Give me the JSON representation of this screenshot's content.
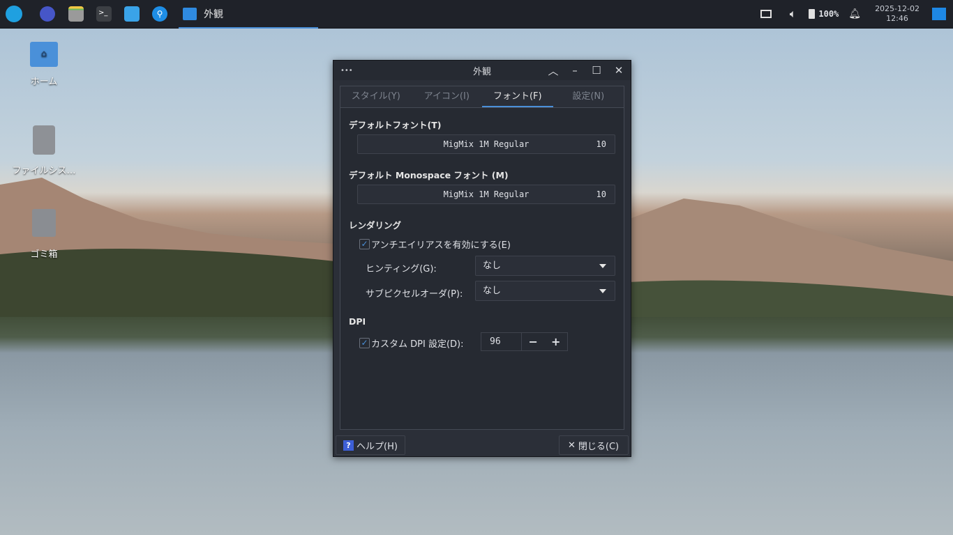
{
  "taskbar": {
    "active_window": "外観",
    "tray": {
      "battery": "100%",
      "date": "2025-12-02",
      "time": "12:46"
    }
  },
  "desktop": {
    "icons": [
      {
        "label": "ホーム"
      },
      {
        "label": "ファイルシス…"
      },
      {
        "label": "ゴミ箱"
      }
    ]
  },
  "window": {
    "title": "外観",
    "tabs": [
      {
        "label": "スタイル(Y)"
      },
      {
        "label": "アイコン(I)"
      },
      {
        "label": "フォント(F)"
      },
      {
        "label": "設定(N)"
      }
    ],
    "default_font": {
      "heading": "デフォルトフォント(T)",
      "name": "MigMix 1M Regular",
      "size": "10"
    },
    "mono_font": {
      "heading": "デフォルト Monospace フォント (M)",
      "name": "MigMix 1M Regular",
      "size": "10"
    },
    "rendering": {
      "heading": "レンダリング",
      "antialias_label": "アンチエイリアスを有効にする(E)",
      "antialias_checked": true,
      "hinting_label": "ヒンティング(G):",
      "hinting_value": "なし",
      "subpixel_label": "サブピクセルオーダ(P):",
      "subpixel_value": "なし"
    },
    "dpi": {
      "heading": "DPI",
      "custom_label": "カスタム DPI 設定(D):",
      "custom_checked": true,
      "value": "96",
      "minus": "−",
      "plus": "+"
    },
    "help_label": "ヘルプ(H)",
    "close_label": "閉じる(C)"
  }
}
